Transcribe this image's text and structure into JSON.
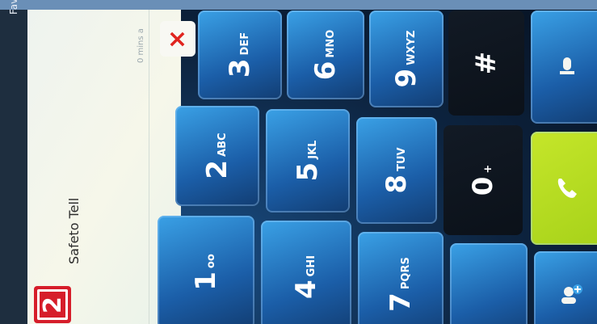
{
  "header": {
    "tab_label": "Favorite"
  },
  "contact": {
    "name": "Safeto Tell",
    "time": "0 mins a",
    "badge": "2"
  },
  "close": {
    "symbol": "×"
  },
  "keys": [
    {
      "num": "3",
      "letters": "DEF"
    },
    {
      "num": "6",
      "letters": "MNO"
    },
    {
      "num": "9",
      "letters": "WXYZ"
    },
    {
      "num": "#",
      "letters": ""
    },
    {
      "num": "2",
      "letters": "ABC"
    },
    {
      "num": "5",
      "letters": "JKL"
    },
    {
      "num": "8",
      "letters": "TUV"
    },
    {
      "num": "0",
      "letters": "+"
    },
    {
      "num": "1",
      "letters": "oo"
    },
    {
      "num": "4",
      "letters": "GHI"
    },
    {
      "num": "7",
      "letters": "PQRS"
    }
  ],
  "icons": {
    "voicemail": "voicemail-icon",
    "mic": "microphone-icon",
    "call": "phone-icon",
    "add_contact": "add-contact-icon"
  },
  "colors": {
    "key_blue": "#1b5ea8",
    "call_green": "#b9dd22",
    "close_red": "#e0241f",
    "badge_red": "#d61d2a"
  }
}
